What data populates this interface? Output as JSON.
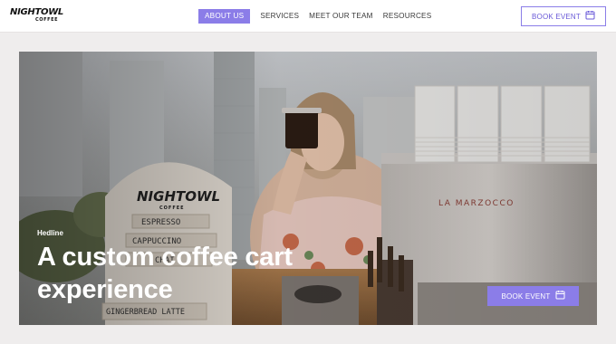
{
  "brand": {
    "logo_main": "NIGHTOWL",
    "logo_sub": "COFFEE"
  },
  "nav": {
    "items": [
      {
        "label": "ABOUT US",
        "active": true
      },
      {
        "label": "SERVICES",
        "active": false
      },
      {
        "label": "MEET OUR TEAM",
        "active": false
      },
      {
        "label": "RESOURCES",
        "active": false
      }
    ]
  },
  "header_cta": {
    "label": "BOOK EVENT",
    "icon": "calendar-icon"
  },
  "hero": {
    "eyebrow": "Hedline",
    "headline": "A custom coffee cart experience",
    "cta_label": "BOOK EVENT",
    "cta_icon": "calendar-icon",
    "menu_sign": {
      "brand": "NIGHTOWL",
      "brand_sub": "COFFEE",
      "items": [
        "ESPRESSO",
        "CAPPUCCINO",
        "CHAI",
        "GINGERBREAD LATTE"
      ]
    },
    "machine_brand": "LA MARZOCCO"
  },
  "colors": {
    "accent": "#8b7de8",
    "header_bg": "#ffffff",
    "page_bg": "#efeded"
  }
}
